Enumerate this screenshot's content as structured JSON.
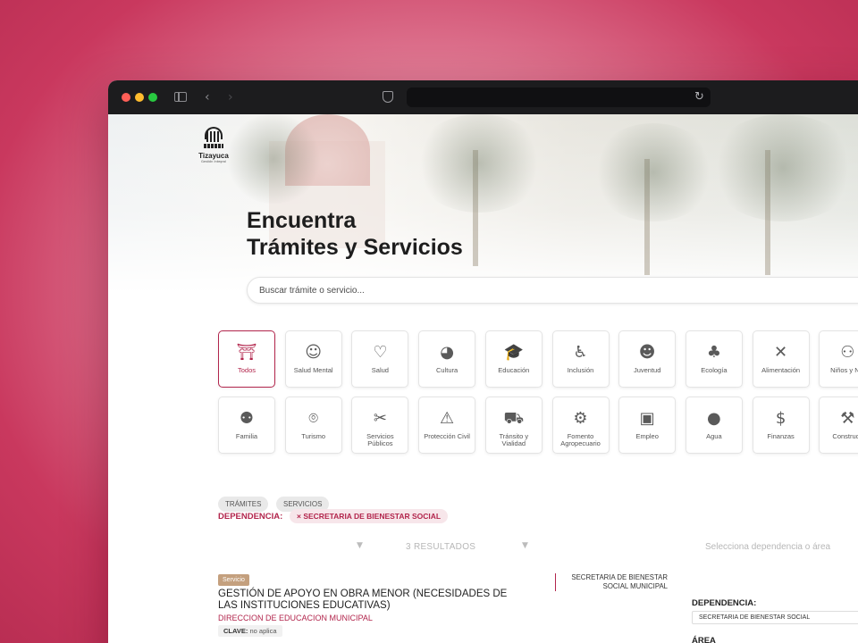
{
  "hero": {
    "title_line1": "Encuentra",
    "title_line2": "Trámites y Servicios",
    "search_placeholder": "Buscar trámite o servicio..."
  },
  "logo": {
    "name": "Tizayuca",
    "tagline": "Gestión Integral"
  },
  "browser": {
    "back_glyph": "‹",
    "forward_glyph": "›",
    "reload_glyph": "↻"
  },
  "categories": [
    {
      "label": "Todos",
      "icon": "arch-logo-icon",
      "glyph": "⛩",
      "active": true
    },
    {
      "label": "Salud Mental",
      "icon": "head-icon",
      "glyph": "☺"
    },
    {
      "label": "Salud",
      "icon": "heartbeat-icon",
      "glyph": "♡"
    },
    {
      "label": "Cultura",
      "icon": "palette-icon",
      "glyph": "◕"
    },
    {
      "label": "Educación",
      "icon": "graduation-cap-icon",
      "glyph": "🎓"
    },
    {
      "label": "Inclusión",
      "icon": "wheelchair-icon",
      "glyph": "♿"
    },
    {
      "label": "Juventud",
      "icon": "smile-icon",
      "glyph": "☻"
    },
    {
      "label": "Ecología",
      "icon": "tree-icon",
      "glyph": "♣"
    },
    {
      "label": "Alimentación",
      "icon": "utensils-icon",
      "glyph": "✕"
    },
    {
      "label": "Niños y Niñ",
      "icon": "children-icon",
      "glyph": "⚇"
    },
    {
      "label": "Familia",
      "icon": "family-icon",
      "glyph": "⚉"
    },
    {
      "label": "Turismo",
      "icon": "map-pin-icon",
      "glyph": "⌾"
    },
    {
      "label": "Servicios Públicos",
      "icon": "tools-icon",
      "glyph": "✂"
    },
    {
      "label": "Protección Civil",
      "icon": "siren-icon",
      "glyph": "⚠"
    },
    {
      "label": "Tránsito y Vialidad",
      "icon": "car-icon",
      "glyph": "⛟"
    },
    {
      "label": "Fomento Agropecuario",
      "icon": "tractor-icon",
      "glyph": "⚙"
    },
    {
      "label": "Empleo",
      "icon": "briefcase-icon",
      "glyph": "▣"
    },
    {
      "label": "Agua",
      "icon": "water-drop-icon",
      "glyph": "●"
    },
    {
      "label": "Finanzas",
      "icon": "dollar-icon",
      "glyph": "$"
    },
    {
      "label": "Construcc",
      "icon": "construction-icon",
      "glyph": "⚒"
    }
  ],
  "type_filters": {
    "tramites": "TRÁMITES",
    "servicios": "SERVICIOS"
  },
  "dependency_filter": {
    "label": "DEPENDENCIA:",
    "selected": "× SECRETARIA DE BIENESTAR SOCIAL"
  },
  "results": {
    "count_text": "3 RESULTADOS",
    "dependency_select_placeholder": "Selecciona dependencia o área"
  },
  "result_item": {
    "badge": "Servicio",
    "title": "GESTIÓN DE APOYO EN OBRA MENOR (NECESIDADES DE LAS INSTITUCIONES EDUCATIVAS)",
    "area": "DIRECCION DE EDUCACION MUNICIPAL",
    "clave_label": "CLAVE:",
    "clave_value": "no aplica",
    "dependency": "SECRETARIA DE BIENESTAR SOCIAL MUNICIPAL"
  },
  "side_filter": {
    "dependencia_label": "DEPENDENCIA:",
    "dependencia_value": "SECRETARIA DE BIENESTAR SOCIAL",
    "area_label": "ÁREA"
  },
  "colors": {
    "accent": "#b2254c",
    "badge": "#c4a07e",
    "background": "#c9385e"
  }
}
